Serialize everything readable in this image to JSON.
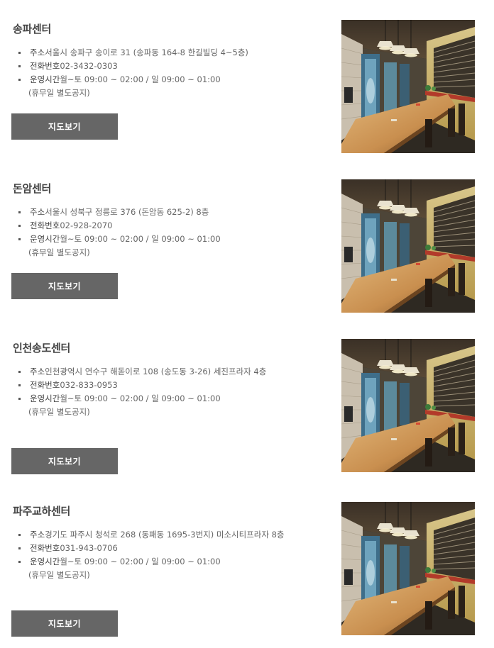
{
  "centers": [
    {
      "name": "송파센터",
      "address_label": "주소",
      "address": "서울시 송파구 송이로 31 (송파동 164-8 한길빌딩 4~5층)",
      "phone_label": "전화번호",
      "phone": "02-3432-0303",
      "hours_label": "운영시간",
      "hours": "월~토 09:00 ~ 02:00 / 일 09:00 ~ 01:00",
      "hours_note": "(휴무일 별도공지)",
      "map_button": "지도보기"
    },
    {
      "name": "돈암센터",
      "address_label": "주소",
      "address": "서울시 성북구 정릉로 376 (돈암동 625-2) 8층",
      "phone_label": "전화번호",
      "phone": "02-928-2070",
      "hours_label": "운영시간",
      "hours": "월~토 09:00 ~ 02:00 / 일 09:00 ~ 01:00",
      "hours_note": "(휴무일 별도공지)",
      "map_button": "지도보기"
    },
    {
      "name": "인천송도센터",
      "address_label": "주소",
      "address": "인천광역시 연수구 해돋이로 108 (송도동 3-26) 세진프라자 4층",
      "phone_label": "전화번호",
      "phone": "032-833-0953",
      "hours_label": "운영시간",
      "hours": "월~토 09:00 ~ 02:00 / 일 09:00 ~ 01:00",
      "hours_note": "(휴무일 별도공지)",
      "map_button": "지도보기"
    },
    {
      "name": "파주교하센터",
      "address_label": "주소",
      "address": "경기도 파주시 청석로 268 (동패동 1695-3번지) 미소시티프라자 8층",
      "phone_label": "전화번호",
      "phone": "031-943-0706",
      "hours_label": "운영시간",
      "hours": "월~토 09:00 ~ 02:00 / 일 09:00 ~ 01:00",
      "hours_note": "(휴무일 별도공지)",
      "map_button": "지도보기"
    }
  ],
  "colors": {
    "button_bg": "#666666",
    "button_text": "#ffffff",
    "text": "#555555",
    "heading": "#444444"
  }
}
